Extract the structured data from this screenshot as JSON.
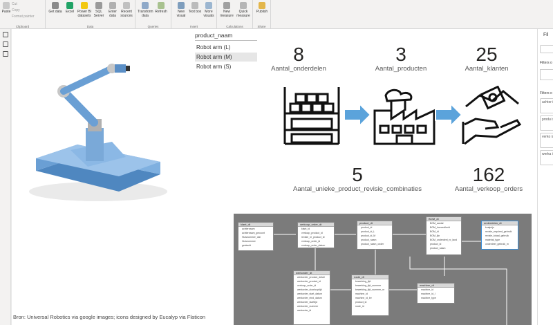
{
  "ribbon": {
    "clipboard": {
      "paste": "Paste",
      "cut": "Cut",
      "copy": "Copy",
      "format": "Format painter",
      "group": "Clipboard"
    },
    "data": {
      "buttons": [
        "Get data",
        "Excel",
        "Power BI datasets",
        "SQL Server",
        "Enter data",
        "Recent sources"
      ],
      "group": "Data"
    },
    "queries": {
      "buttons": [
        "Transform data",
        "Refresh"
      ],
      "group": "Queries"
    },
    "insert": {
      "buttons": [
        "New visual",
        "Text box",
        "More visuals"
      ],
      "group": "Insert"
    },
    "calculations": {
      "buttons": [
        "New measure",
        "Quick measure"
      ],
      "group": "Calculations"
    },
    "share": {
      "buttons": [
        "Publish"
      ],
      "group": "Share"
    }
  },
  "filters": {
    "title": "Fil",
    "on_label": "Filters o",
    "on_label2": "Filters o",
    "fields": [
      "achter is (All)",
      "produ is (All)",
      "verko is (All)",
      "werka is (All)"
    ]
  },
  "slicer": {
    "header": "product_naam",
    "items": [
      "Robot arm (L)",
      "Robot arm (M)",
      "Robot arm (S)"
    ],
    "selected": 1
  },
  "cards": [
    {
      "value": "8",
      "label": "Aantal_onderdelen"
    },
    {
      "value": "3",
      "label": "Aantal_producten"
    },
    {
      "value": "25",
      "label": "Aantal_klanten"
    },
    {
      "value": "5",
      "label": "Aantal_unieke_product_revisie_combinaties"
    },
    {
      "value": "162",
      "label": "Aantal_verkoop_orders"
    }
  ],
  "footer": "Bron: Universal Robotics via google images; icons designed by Eucalyp via Flaticon",
  "model": {
    "tables": [
      {
        "name": "klant_dt",
        "rows": [
          "achternaam",
          "achternaam_gecoont",
          "Huisnummer_dat",
          "Huisnummer",
          "geslacht"
        ]
      },
      {
        "name": "verkoop_order_dt",
        "rows": [
          "klant_id",
          "verkoop_product_id",
          "revisie_nr_product_id",
          "verkoop_order_id",
          "verkoop_order_datum"
        ]
      },
      {
        "name": "product_dt",
        "rows": [
          "product_id",
          "product_id_L",
          "product_id_M",
          "product_naam",
          "product_naam_onder"
        ]
      },
      {
        "name": "BOM_dt",
        "rows": [
          "BOM_aantal",
          "BOM_hoeveelheid",
          "BOM_id",
          "BOM_lijn",
          "BOM_onderdeel_nr_land",
          "product_id",
          "product_naam"
        ]
      },
      {
        "name": "onderdelen_dt",
        "rows": [
          "kostprijs",
          "revisie_required_gebruik",
          "revisie_totaal_gebruik",
          "material_type",
          "onderdeel_gebruik_m"
        ]
      },
      {
        "name": "werkorder_dt",
        "rows": [
          "werkorder_product_detail",
          "werkorder_product_id",
          "verkoop_order_id",
          "werkorder_doorlooptijd",
          "werkorder_start_datum",
          "werkorder_eind_datum",
          "werkorder_starttijd",
          "werkorder_nummer",
          "werkorder_id"
        ]
      },
      {
        "name": "route_dt",
        "rows": [
          "bewerking_tijd",
          "bewerking_tijd_nummer",
          "bewerking_tijd_nummer_nr",
          "machine_id",
          "machine_id_lnr",
          "product_id",
          "route_id"
        ]
      },
      {
        "name": "machine_dt",
        "rows": [
          "machine_id",
          "machine_id_l",
          "machine_type"
        ]
      }
    ]
  },
  "colors": {
    "accent": "#2b7bc8",
    "arrow": "#5ba3db",
    "robot": "#6a9fd4"
  }
}
